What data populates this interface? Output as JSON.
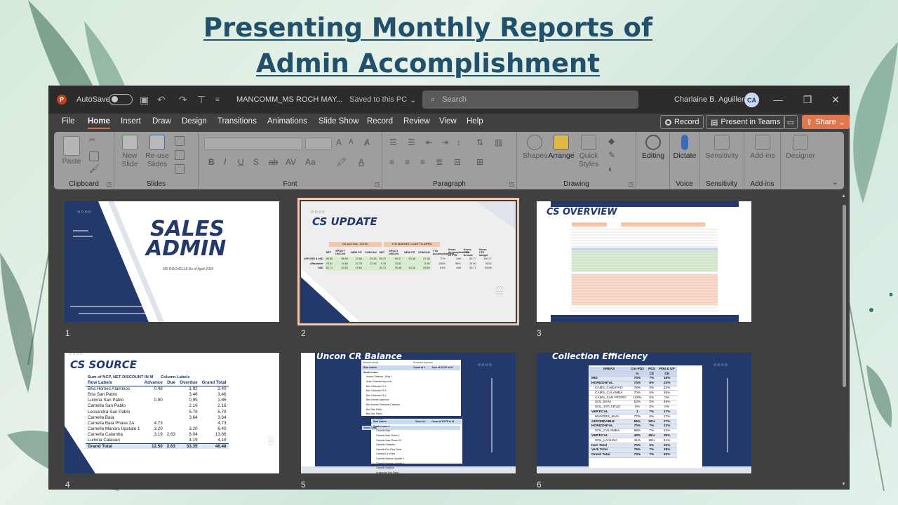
{
  "slide_title": [
    "Presenting Monthly Reports of",
    "Admin Accomplishment"
  ],
  "titlebar": {
    "logo": "P",
    "autosave_label": "AutoSave",
    "filename": "MANCOMM_MS ROCH MAY...",
    "saved_status": "Saved to this PC",
    "search_placeholder": "Search",
    "user_name": "Charlaine B. Aguillera",
    "user_initials": "CA"
  },
  "menu": {
    "tabs": [
      "File",
      "Home",
      "Insert",
      "Draw",
      "Design",
      "Transitions",
      "Animations",
      "Slide Show",
      "Record",
      "Review",
      "View",
      "Help"
    ],
    "active_tab": "Home",
    "record_label": "Record",
    "teams_label": "Present in Teams",
    "share_label": "Share"
  },
  "ribbon": {
    "groups": [
      "Clipboard",
      "Slides",
      "Font",
      "Paragraph",
      "Drawing",
      "Voice",
      "Sensitivity",
      "Add-ins"
    ],
    "paste": "Paste",
    "new_slide": [
      "New",
      "Slide"
    ],
    "reuse_slides": [
      "Re-use",
      "Slides"
    ],
    "shapes": "Shapes",
    "arrange": "Arrange",
    "quick_styles": [
      "Quick",
      "Styles"
    ],
    "editing": "Editing",
    "dictate": "Dictate",
    "sensitivity": "Sensitivity",
    "addins": "Add-ins",
    "designer": "Designer",
    "font_buttons": [
      "B",
      "I",
      "U",
      "S",
      "ab",
      "AV",
      "Aa"
    ]
  },
  "slides": {
    "numbers": [
      "1",
      "2",
      "3",
      "4",
      "5",
      "6"
    ],
    "s1": {
      "title_line1": "SALES",
      "title_line2": "ADMIN",
      "subtitle": "MS ROCHELLE As of April 2024"
    },
    "s2": {
      "title": "CS UPDATE",
      "header_left": "CS ACTUAL TOTAL",
      "header_right": "YTD BUDGET LOAN TO APRIL",
      "cols": [
        "NET",
        "SPOOT UNCON",
        "NEW PIT",
        "CONCAN",
        "NET",
        "SPOOT UNCON",
        "NEW PIT",
        "CONCAN",
        "YTD Accomplishment",
        "Gross Accomplishment vs YTD",
        "Gross YTD Annual",
        "Gross YTD budget"
      ],
      "rows": [
        [
          "AFFORD & MID",
          "88.55",
          "88.00",
          "22.56",
          "25.26",
          "60.72",
          "90.37",
          "43.36",
          "47.38",
          "77%",
          "Mid",
          "63.77",
          "100.27"
        ],
        [
          "Affordable",
          "78.51",
          "20.60",
          "10.78",
          "22.46",
          "9.78",
          "70.62",
          "",
          "8.90",
          "100%",
          "96%",
          "29.90",
          "78.50"
        ],
        [
          "MID",
          "80.71",
          "63.00",
          "10.62",
          "",
          "30.73",
          "76.46",
          "43.36",
          "43.56",
          "61%",
          "Mid",
          "33.71",
          "55.58"
        ]
      ]
    },
    "s3": {
      "title": "CS OVERVIEW"
    },
    "s4": {
      "title": "CS SOURCE",
      "pivot_title": "Sum of NCP, NET DISCOUNT IN M",
      "column_labels": "Column Labels",
      "headers": [
        "Row Labels",
        "Advance",
        "Due",
        "Overdue",
        "Grand Total"
      ],
      "rows": [
        [
          "Bria Homes Alaminos",
          "0.48",
          "",
          "1.92",
          "2.40"
        ],
        [
          "Bria San Pablo",
          "",
          "",
          "3.46",
          "3.46"
        ],
        [
          "Lumina San Pablo",
          "0.90",
          "",
          "0.95",
          "1.85"
        ],
        [
          "Camella San Pablo",
          "",
          "",
          "2.16",
          "2.16"
        ],
        [
          "Lessandra San Pablo",
          "",
          "",
          "5.79",
          "5.79"
        ],
        [
          "Camella Baia",
          "",
          "",
          "3.64",
          "3.64"
        ],
        [
          "Camella Baia Phase 2A",
          "4.73",
          "",
          "",
          "4.73"
        ],
        [
          "Camella Manors Upstate 1",
          "3.20",
          "",
          "3.20",
          "6.40"
        ],
        [
          "Camella Calamba",
          "3.19",
          "2.63",
          "8.04",
          "13.86"
        ],
        [
          "Lumina Calauan",
          "",
          "",
          "4.19",
          "4.19"
        ]
      ],
      "total": [
        "Grand Total",
        "12.50",
        "2.63",
        "33.35",
        "48.48"
      ]
    },
    "s5": {
      "title": "Uncon CR Balance",
      "division_head": "Division Head",
      "division_value": "Rochelle Alyanan",
      "t1_headers": [
        "Row Labels",
        "Count of #",
        "Sum of NTCP in M"
      ],
      "t1_group": "South Luzon",
      "t1_rows": [
        "Amaia Calamba - Bldg 1",
        "Avira Calamba Aqueous",
        "Bria Calamba Ph 4",
        "Bria Calamba Ph 5",
        "Bria Calamba Ph 2",
        "Bria Homes Alaminos",
        "Bria Homes Executive Calamba",
        "Bria San Pablo",
        "Bria San Pablo",
        "Lumina Calauan",
        "Lumina San Pablo"
      ],
      "t1_total": "Grand Total",
      "t2_headers": [
        "Row Labels",
        "Sum of #",
        "Count of NTCP in M"
      ],
      "t2_group": "South Luzon 2",
      "t2_rows": [
        "Camella Baia",
        "Camella Baia Phase 2",
        "Camella Baia Phase 2A",
        "Camella Calamba",
        "Camella Dos Rios Trails",
        "Camella La Vicina",
        "Camella Manors Upstate 1",
        "Camella Manors Upstate 2",
        "Camella Sublime",
        "Lessandra San Pablo"
      ],
      "t2_total": "Grand Total"
    },
    "s6": {
      "title": "Collection Efficiency",
      "headers": [
        "AREAS",
        "Cur-PD2",
        "PD3",
        "PD4 & UP"
      ],
      "subheaders": [
        "",
        "%",
        "CE",
        "CE"
      ],
      "rows": [
        [
          "MID",
          "75%",
          "7%",
          "18%"
        ],
        [
          "HORIZONTAL",
          "70%",
          "6%",
          "23%"
        ],
        [
          "CAMS_CABUYAO",
          "78%",
          "0%",
          "22%"
        ],
        [
          "CAMS_CALAMBA",
          "70%",
          "5%",
          "26%"
        ],
        [
          "CAMS_SAN PEDRO",
          "100%",
          "0%",
          "0%"
        ],
        [
          "SOL_BAIA",
          "52%",
          "0%",
          "48%"
        ],
        [
          "SOL_STA.CRUZ",
          "0%",
          "0%",
          "0%"
        ],
        [
          "VERTICAL",
          "1",
          "7%",
          "17%"
        ],
        [
          "MANORS_BAIA",
          "77%",
          "6%",
          "17%"
        ],
        [
          "AFFORDABLE",
          "65%",
          "10%",
          "27%"
        ],
        [
          "HORIZONTAL",
          "70%",
          "7%",
          "23%"
        ],
        [
          "SOL_CALAMBA",
          "69%",
          "7%",
          "24%"
        ],
        [
          "VERTICAL",
          "49%",
          "16%",
          "35%"
        ],
        [
          "SOL_LAGUNA",
          "41%",
          "18%",
          "41%"
        ],
        [
          "Hori Total",
          "70%",
          "6%",
          "23%"
        ],
        [
          "Verti Total",
          "75%",
          "7%",
          "18%"
        ],
        [
          "Grand Total",
          "73%",
          "7%",
          "20%"
        ]
      ]
    }
  },
  "colors": {
    "navy": "#23396b",
    "accent": "#d86a4b",
    "title_color": "#21506b",
    "app_bg": "#404040",
    "ribbon_bg": "#9e9e9e"
  }
}
